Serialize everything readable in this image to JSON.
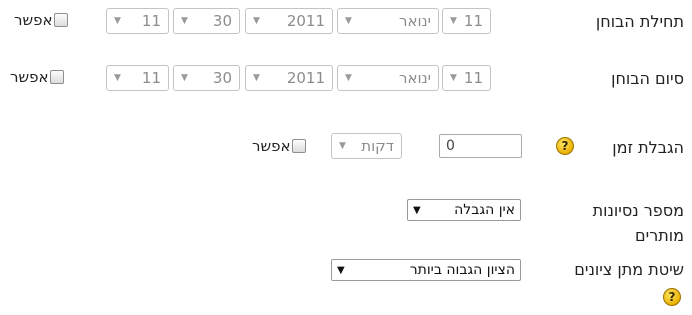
{
  "quiz_open": {
    "label": "תחילת הבוחן",
    "day": "11",
    "month": "ינואר",
    "year": "2011",
    "hour": "30",
    "minute": "11",
    "enable_label": "אפשר"
  },
  "quiz_close": {
    "label": "סיום הבוחן",
    "day": "11",
    "month": "ינואר",
    "year": "2011",
    "hour": "30",
    "minute": "11",
    "enable_label": "אפשר"
  },
  "time_limit": {
    "label": "הגבלת זמן",
    "value": "0",
    "unit": "דקות",
    "enable_label": "אפשר"
  },
  "attempts": {
    "label_line1": "מספר נסיונות",
    "label_line2": "מותרים",
    "selected": "אין הגבלה"
  },
  "grading": {
    "label": "שיטת מתן ציונים",
    "selected": "הציון הגבוה ביותר"
  },
  "icons": {
    "arrow": "▼",
    "help_glyph": "?"
  },
  "colors": {
    "help_icon": "#e9b000",
    "disabled_text": "#8c8c8c"
  }
}
